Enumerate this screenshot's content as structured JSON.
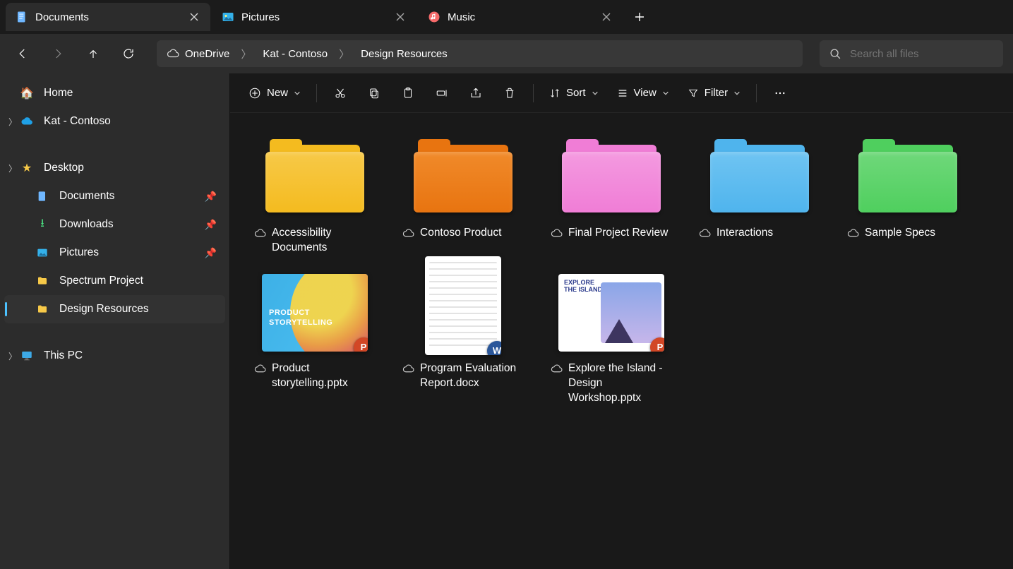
{
  "tabs": [
    {
      "label": "Documents",
      "iconColor": "#6fb7ff",
      "active": true
    },
    {
      "label": "Pictures",
      "iconColor": "#34b1ea",
      "active": false
    },
    {
      "label": "Music",
      "iconColor": "#f76a6a",
      "active": false
    }
  ],
  "breadcrumbs": [
    "OneDrive",
    "Kat - Contoso",
    "Design Resources"
  ],
  "search": {
    "placeholder": "Search all files"
  },
  "toolbar": {
    "new": "New",
    "sort": "Sort",
    "view": "View",
    "filter": "Filter"
  },
  "sidebar": {
    "top": [
      {
        "label": "Home",
        "icon": "home",
        "expandable": false
      },
      {
        "label": "Kat - Contoso",
        "icon": "onedrive",
        "expandable": true
      }
    ],
    "quick": [
      {
        "label": "Desktop",
        "icon": "star",
        "expandable": true,
        "pinned": false
      },
      {
        "label": "Documents",
        "icon": "docs",
        "pinned": true
      },
      {
        "label": "Downloads",
        "icon": "download",
        "pinned": true
      },
      {
        "label": "Pictures",
        "icon": "pictures",
        "pinned": true
      },
      {
        "label": "Spectrum Project",
        "icon": "folder",
        "pinned": false
      },
      {
        "label": "Design Resources",
        "icon": "folder",
        "pinned": false,
        "selected": true
      }
    ],
    "bottom": [
      {
        "label": "This PC",
        "icon": "pc",
        "expandable": true
      }
    ]
  },
  "folders": [
    {
      "name": "Accessibility Documents",
      "color": "#f7c948",
      "shade": "#f4bb1f"
    },
    {
      "name": "Contoso Product",
      "color": "#f08a2a",
      "shade": "#e87410"
    },
    {
      "name": "Final Project Review",
      "color": "#f49ae0",
      "shade": "#f07dd6"
    },
    {
      "name": "Interactions",
      "color": "#6fc4f2",
      "shade": "#4fb4ed"
    },
    {
      "name": "Sample Specs",
      "color": "#6fd87a",
      "shade": "#4fcf5e"
    }
  ],
  "files": [
    {
      "name": "Product storytelling.pptx",
      "type": "pptx",
      "thumbTitle": "PRODUCT\nSTORYTELLING"
    },
    {
      "name": "Program Evaluation Report.docx",
      "type": "docx"
    },
    {
      "name": "Explore the Island - Design Workshop.pptx",
      "type": "pptx",
      "island": true,
      "thumbTitle": "EXPLORE\nTHE ISLAND"
    }
  ]
}
